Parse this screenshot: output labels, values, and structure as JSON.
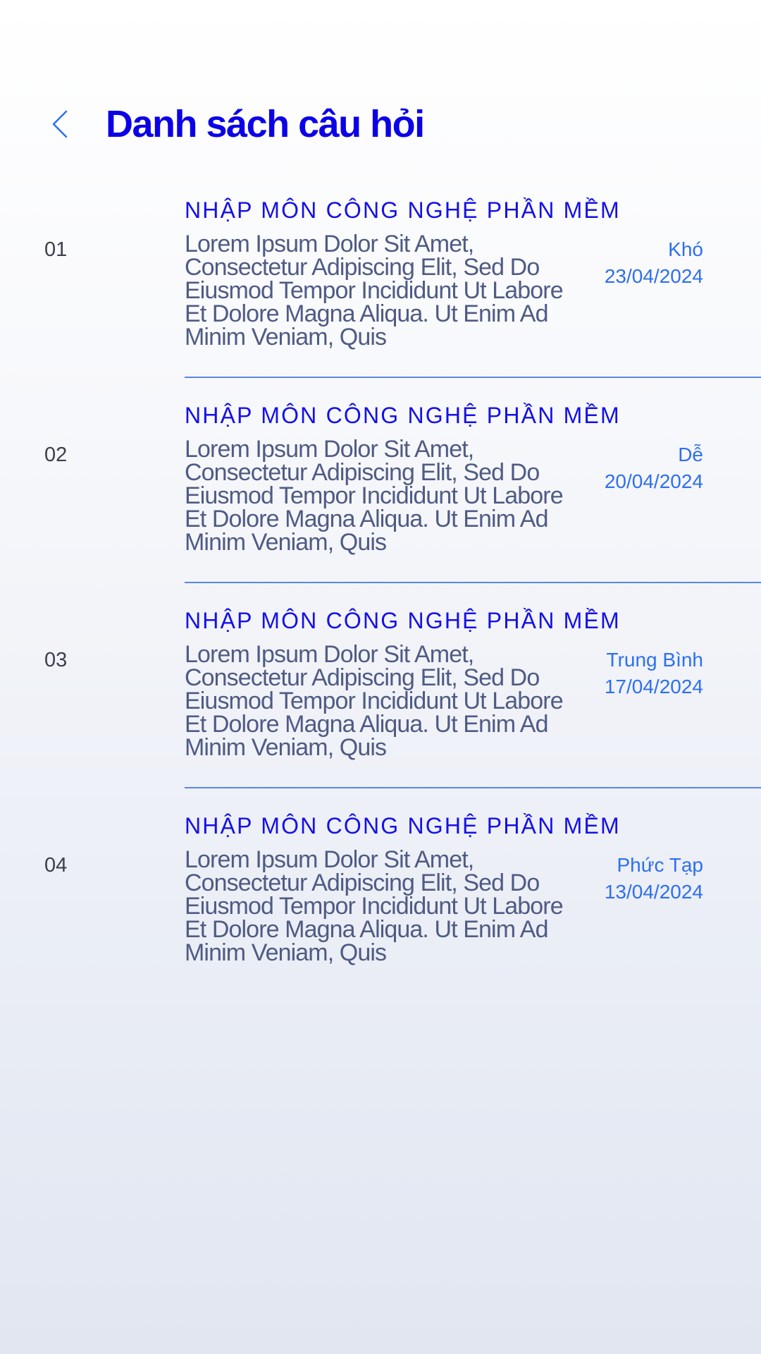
{
  "header": {
    "title": "Danh sách câu hỏi",
    "back_icon": "chevron-left-icon"
  },
  "colors": {
    "title": "#0b00e6",
    "subject": "#1410e8",
    "meta": "#2d6ff0",
    "divider": "#5a86e6",
    "body_text": "#4f5b84",
    "number": "#3b3f4d"
  },
  "questions": [
    {
      "number": "01",
      "subject": "NHẬP MÔN CÔNG NGHỆ PHẦN MỀM",
      "text": "Lorem Ipsum Dolor Sit Amet, Consectetur Adipiscing Elit, Sed Do Eiusmod Tempor Incididunt Ut Labore Et Dolore Magna Aliqua. Ut Enim Ad Minim Veniam, Quis",
      "level": "Khó",
      "date": "23/04/2024"
    },
    {
      "number": "02",
      "subject": "NHẬP MÔN CÔNG NGHỆ PHẦN MỀM",
      "text": "Lorem Ipsum Dolor Sit Amet, Consectetur Adipiscing Elit, Sed Do Eiusmod Tempor Incididunt Ut Labore Et Dolore Magna Aliqua. Ut Enim Ad Minim Veniam, Quis",
      "level": "Dễ",
      "date": "20/04/2024"
    },
    {
      "number": "03",
      "subject": "NHẬP MÔN CÔNG NGHỆ PHẦN MỀM",
      "text": "Lorem Ipsum Dolor Sit Amet, Consectetur Adipiscing Elit, Sed Do Eiusmod Tempor Incididunt Ut Labore Et Dolore Magna Aliqua. Ut Enim Ad Minim Veniam, Quis",
      "level": "Trung Bình",
      "date": "17/04/2024"
    },
    {
      "number": "04",
      "subject": "NHẬP MÔN CÔNG NGHỆ PHẦN MỀM",
      "text": "Lorem Ipsum Dolor Sit Amet, Consectetur Adipiscing Elit, Sed Do Eiusmod Tempor Incididunt Ut Labore Et Dolore Magna Aliqua. Ut Enim Ad Minim Veniam, Quis",
      "level": "Phức Tạp",
      "date": "13/04/2024"
    }
  ]
}
